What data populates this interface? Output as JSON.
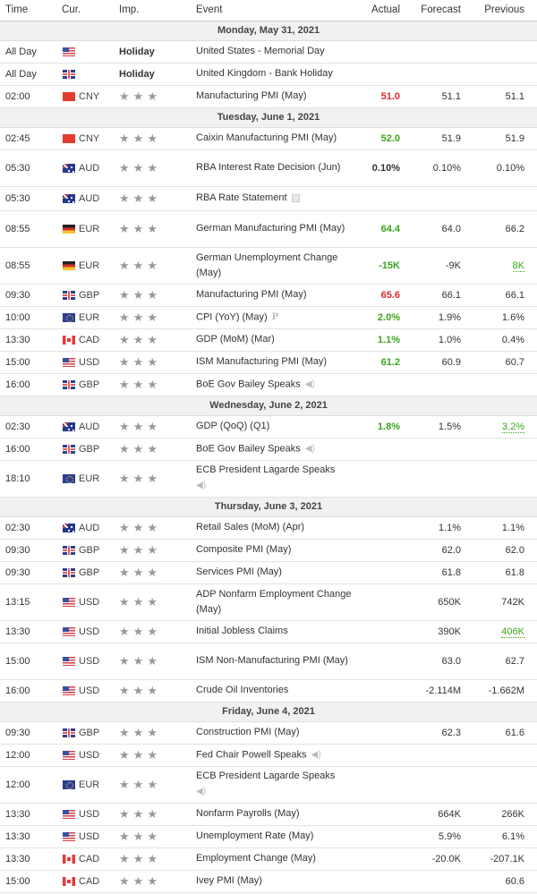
{
  "columns": {
    "time": "Time",
    "currency": "Cur.",
    "importance": "Imp.",
    "event": "Event",
    "actual": "Actual",
    "forecast": "Forecast",
    "previous": "Previous"
  },
  "icons": {
    "star": "★",
    "speaker": "🔈",
    "preliminary": "P"
  },
  "colors": {
    "better": "#3aa51b",
    "worse": "#e3262c",
    "star": "#999999",
    "day_header_bg": "#f1f1f1"
  },
  "days": [
    {
      "label": "Monday, May 31, 2021",
      "events": [
        {
          "time": "All Day",
          "flag": "us",
          "currency": "",
          "importance": "Holiday",
          "event": "United States - Memorial Day",
          "actual": "",
          "forecast": "",
          "previous": ""
        },
        {
          "time": "All Day",
          "flag": "gb",
          "currency": "",
          "importance": "Holiday",
          "event": "United Kingdom - Bank Holiday",
          "actual": "",
          "forecast": "",
          "previous": ""
        },
        {
          "time": "02:00",
          "flag": "cn",
          "currency": "CNY",
          "importance": 3,
          "event": "Manufacturing PMI (May)",
          "actual": "51.0",
          "actual_status": "worse",
          "forecast": "51.1",
          "previous": "51.1"
        }
      ]
    },
    {
      "label": "Tuesday, June 1, 2021",
      "events": [
        {
          "time": "02:45",
          "flag": "cn",
          "currency": "CNY",
          "importance": 3,
          "event": "Caixin Manufacturing PMI (May)",
          "actual": "52.0",
          "actual_status": "better",
          "forecast": "51.9",
          "previous": "51.9"
        },
        {
          "time": "05:30",
          "flag": "au",
          "currency": "AUD",
          "importance": 3,
          "event": "RBA Interest Rate Decision (Jun)",
          "actual": "0.10%",
          "actual_status": "neutral",
          "forecast": "0.10%",
          "previous": "0.10%"
        },
        {
          "time": "05:30",
          "flag": "au",
          "currency": "AUD",
          "importance": 3,
          "event": "RBA Rate Statement",
          "event_icon": "document-icon",
          "actual": "",
          "forecast": "",
          "previous": ""
        },
        {
          "time": "08:55",
          "flag": "de",
          "currency": "EUR",
          "importance": 3,
          "event": "German Manufacturing PMI (May)",
          "actual": "64.4",
          "actual_status": "better",
          "forecast": "64.0",
          "previous": "66.2"
        },
        {
          "time": "08:55",
          "flag": "de",
          "currency": "EUR",
          "importance": 3,
          "event": "German Unemployment Change (May)",
          "actual": "-15K",
          "actual_status": "better",
          "forecast": "-9K",
          "previous": "8K",
          "previous_status": "revised-better"
        },
        {
          "time": "09:30",
          "flag": "gb",
          "currency": "GBP",
          "importance": 3,
          "event": "Manufacturing PMI (May)",
          "actual": "65.6",
          "actual_status": "worse",
          "forecast": "66.1",
          "previous": "66.1"
        },
        {
          "time": "10:00",
          "flag": "eu",
          "currency": "EUR",
          "importance": 3,
          "event": "CPI (YoY) (May)",
          "event_icon": "preliminary-icon",
          "actual": "2.0%",
          "actual_status": "better",
          "forecast": "1.9%",
          "previous": "1.6%"
        },
        {
          "time": "13:30",
          "flag": "ca",
          "currency": "CAD",
          "importance": 3,
          "event": "GDP (MoM) (Mar)",
          "actual": "1.1%",
          "actual_status": "better",
          "forecast": "1.0%",
          "previous": "0.4%"
        },
        {
          "time": "15:00",
          "flag": "us",
          "currency": "USD",
          "importance": 3,
          "event": "ISM Manufacturing PMI (May)",
          "actual": "61.2",
          "actual_status": "better",
          "forecast": "60.9",
          "previous": "60.7"
        },
        {
          "time": "16:00",
          "flag": "gb",
          "currency": "GBP",
          "importance": 3,
          "event": "BoE Gov Bailey Speaks",
          "event_icon": "speaker-icon",
          "actual": "",
          "forecast": "",
          "previous": ""
        }
      ]
    },
    {
      "label": "Wednesday, June 2, 2021",
      "events": [
        {
          "time": "02:30",
          "flag": "au",
          "currency": "AUD",
          "importance": 3,
          "event": "GDP (QoQ) (Q1)",
          "actual": "1.8%",
          "actual_status": "better",
          "forecast": "1.5%",
          "previous": "3.2%",
          "previous_status": "revised-better"
        },
        {
          "time": "16:00",
          "flag": "gb",
          "currency": "GBP",
          "importance": 3,
          "event": "BoE Gov Bailey Speaks",
          "event_icon": "speaker-icon",
          "actual": "",
          "forecast": "",
          "previous": ""
        },
        {
          "time": "18:10",
          "flag": "eu",
          "currency": "EUR",
          "importance": 3,
          "event": "ECB President Lagarde Speaks",
          "event_icon": "speaker-icon",
          "icon_wrap": true,
          "actual": "",
          "forecast": "",
          "previous": ""
        }
      ]
    },
    {
      "label": "Thursday, June 3, 2021",
      "events": [
        {
          "time": "02:30",
          "flag": "au",
          "currency": "AUD",
          "importance": 3,
          "event": "Retail Sales (MoM) (Apr)",
          "actual": "",
          "forecast": "1.1%",
          "previous": "1.1%"
        },
        {
          "time": "09:30",
          "flag": "gb",
          "currency": "GBP",
          "importance": 3,
          "event": "Composite PMI (May)",
          "actual": "",
          "forecast": "62.0",
          "previous": "62.0"
        },
        {
          "time": "09:30",
          "flag": "gb",
          "currency": "GBP",
          "importance": 3,
          "event": "Services PMI (May)",
          "actual": "",
          "forecast": "61.8",
          "previous": "61.8"
        },
        {
          "time": "13:15",
          "flag": "us",
          "currency": "USD",
          "importance": 3,
          "event": "ADP Nonfarm Employment Change (May)",
          "actual": "",
          "forecast": "650K",
          "previous": "742K"
        },
        {
          "time": "13:30",
          "flag": "us",
          "currency": "USD",
          "importance": 3,
          "event": "Initial Jobless Claims",
          "actual": "",
          "forecast": "390K",
          "previous": "406K",
          "previous_status": "revised-better"
        },
        {
          "time": "15:00",
          "flag": "us",
          "currency": "USD",
          "importance": 3,
          "event": "ISM Non-Manufacturing PMI (May)",
          "actual": "",
          "forecast": "63.0",
          "previous": "62.7"
        },
        {
          "time": "16:00",
          "flag": "us",
          "currency": "USD",
          "importance": 3,
          "event": "Crude Oil Inventories",
          "actual": "",
          "forecast": "-2.114M",
          "previous": "-1.662M"
        }
      ]
    },
    {
      "label": "Friday, June 4, 2021",
      "events": [
        {
          "time": "09:30",
          "flag": "gb",
          "currency": "GBP",
          "importance": 3,
          "event": "Construction PMI (May)",
          "actual": "",
          "forecast": "62.3",
          "previous": "61.6"
        },
        {
          "time": "12:00",
          "flag": "us",
          "currency": "USD",
          "importance": 3,
          "event": "Fed Chair Powell Speaks",
          "event_icon": "speaker-icon",
          "actual": "",
          "forecast": "",
          "previous": ""
        },
        {
          "time": "12:00",
          "flag": "eu",
          "currency": "EUR",
          "importance": 3,
          "event": "ECB President Lagarde Speaks",
          "event_icon": "speaker-icon",
          "icon_wrap": true,
          "actual": "",
          "forecast": "",
          "previous": ""
        },
        {
          "time": "13:30",
          "flag": "us",
          "currency": "USD",
          "importance": 3,
          "event": "Nonfarm Payrolls (May)",
          "actual": "",
          "forecast": "664K",
          "previous": "266K"
        },
        {
          "time": "13:30",
          "flag": "us",
          "currency": "USD",
          "importance": 3,
          "event": "Unemployment Rate (May)",
          "actual": "",
          "forecast": "5.9%",
          "previous": "6.1%"
        },
        {
          "time": "13:30",
          "flag": "ca",
          "currency": "CAD",
          "importance": 3,
          "event": "Employment Change (May)",
          "actual": "",
          "forecast": "-20.0K",
          "previous": "-207.1K"
        },
        {
          "time": "15:00",
          "flag": "ca",
          "currency": "CAD",
          "importance": 3,
          "event": "Ivey PMI (May)",
          "actual": "",
          "forecast": "",
          "previous": "60.6"
        }
      ]
    }
  ]
}
